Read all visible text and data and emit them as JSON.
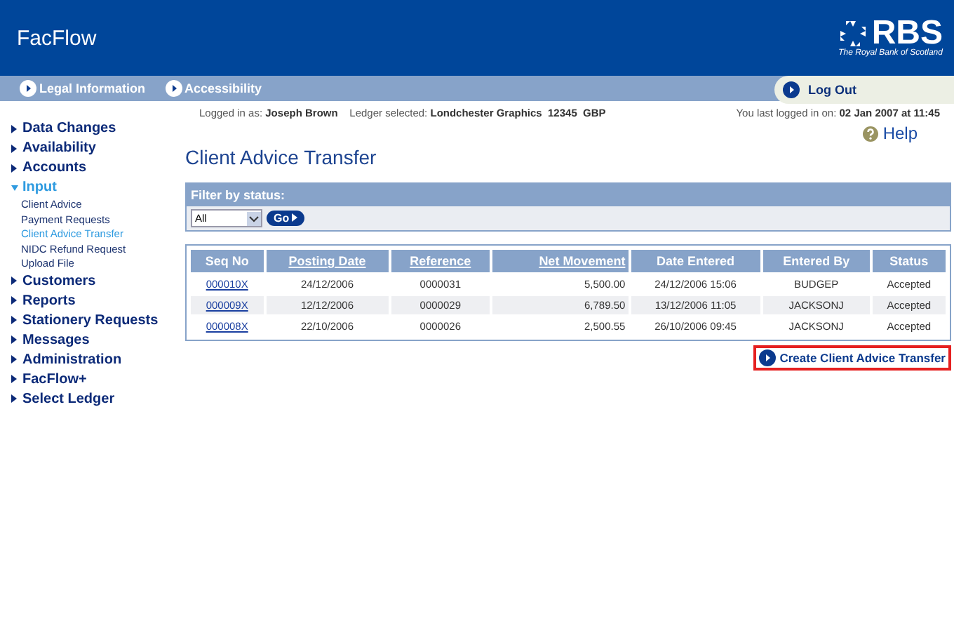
{
  "header": {
    "app_title": "FacFlow",
    "logo_word": "RBS",
    "logo_tagline": "The Royal Bank of Scotland"
  },
  "top_nav": {
    "links": [
      "Legal Information",
      "Accessibility"
    ],
    "logout": "Log Out"
  },
  "sidebar": {
    "items": [
      {
        "label": "Data Changes",
        "expanded": false
      },
      {
        "label": "Availability",
        "expanded": false
      },
      {
        "label": "Accounts",
        "expanded": false
      },
      {
        "label": "Input",
        "expanded": true,
        "children": [
          {
            "label": "Client Advice",
            "selected": false
          },
          {
            "label": "Payment Requests",
            "selected": false
          },
          {
            "label": "Client Advice Transfer",
            "selected": true
          },
          {
            "label": "NIDC Refund Request",
            "selected": false
          },
          {
            "label": "Upload File",
            "selected": false
          }
        ]
      },
      {
        "label": "Customers",
        "expanded": false
      },
      {
        "label": "Reports",
        "expanded": false
      },
      {
        "label": "Stationery Requests",
        "expanded": false
      },
      {
        "label": "Messages",
        "expanded": false
      },
      {
        "label": "Administration",
        "expanded": false
      },
      {
        "label": "FacFlow+",
        "expanded": false
      },
      {
        "label": "Select Ledger",
        "expanded": false
      }
    ]
  },
  "session": {
    "logged_in_label": "Logged in as:",
    "user": "Joseph Brown",
    "ledger_label": "Ledger selected:",
    "ledger": "Londchester Graphics  12345  GBP",
    "last_login_label": "You last logged in on:",
    "last_login": "02 Jan 2007 at 11:45"
  },
  "help": "Help",
  "page_title": "Client Advice Transfer",
  "filter": {
    "title": "Filter by status:",
    "value": "All",
    "go": "Go"
  },
  "table": {
    "columns": [
      {
        "label": "Seq No",
        "sortable": false
      },
      {
        "label": "Posting Date",
        "sortable": true
      },
      {
        "label": "Reference",
        "sortable": true
      },
      {
        "label": "Net Movement",
        "sortable": true,
        "kind": "amount"
      },
      {
        "label": "Date Entered",
        "sortable": false
      },
      {
        "label": "Entered By",
        "sortable": false
      },
      {
        "label": "Status",
        "sortable": false
      }
    ],
    "rows": [
      [
        "000010X",
        "24/12/2006",
        "0000031",
        "5,500.00",
        "24/12/2006 15:06",
        "BUDGEP",
        "Accepted"
      ],
      [
        "000009X",
        "12/12/2006",
        "0000029",
        "6,789.50",
        "13/12/2006 11:05",
        "JACKSONJ",
        "Accepted"
      ],
      [
        "000008X",
        "22/10/2006",
        "0000026",
        "2,500.55",
        "26/10/2006 09:45",
        "JACKSONJ",
        "Accepted"
      ]
    ]
  },
  "create_link": {
    "label": "Create Client Advice Transfer",
    "highlighted": true
  }
}
